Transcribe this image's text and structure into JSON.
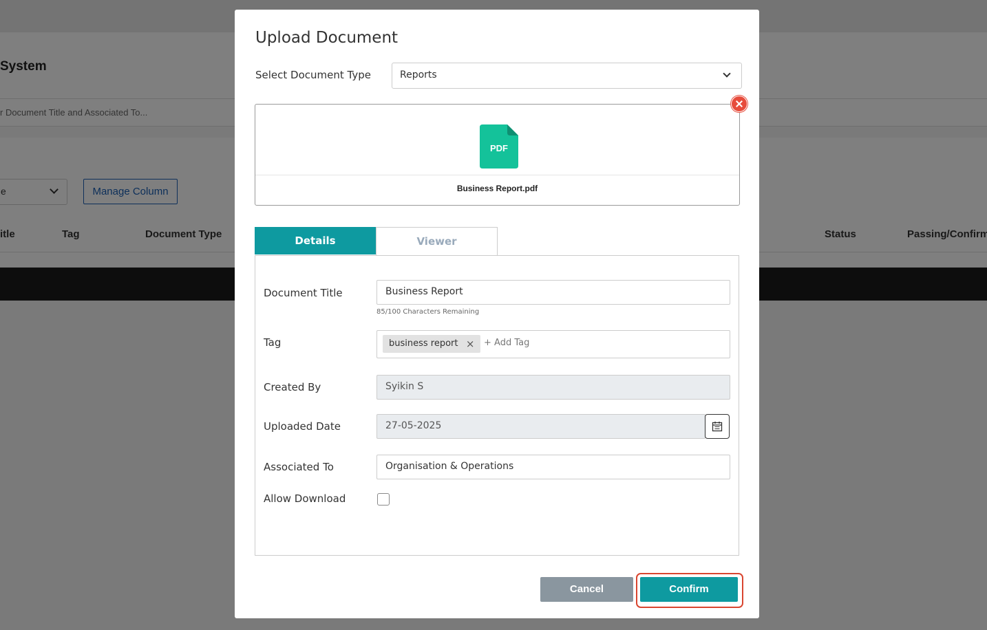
{
  "background": {
    "system_title": "System",
    "search_placeholder": "r Document Title and Associated To...",
    "select_value": "e",
    "manage_column": "Manage Column",
    "headers": [
      "itle",
      "Tag",
      "Document Type",
      "Status",
      "Passing/Confirm"
    ]
  },
  "modal": {
    "title": "Upload Document",
    "doc_type_label": "Select Document Type",
    "doc_type_value": "Reports",
    "file": {
      "icon_text": "PDF",
      "name": "Business Report.pdf",
      "icon_color": "#14c29a"
    },
    "tabs": [
      {
        "label": "Details",
        "active": true
      },
      {
        "label": "Viewer",
        "active": false
      }
    ],
    "fields": {
      "document_title": {
        "label": "Document Title",
        "value": "Business Report",
        "hint": "85/100 Characters Remaining"
      },
      "tag": {
        "label": "Tag",
        "chips": [
          "business report"
        ],
        "chip_remove": "×",
        "add_label": "+ Add Tag"
      },
      "created_by": {
        "label": "Created By",
        "value": "Syikin S"
      },
      "uploaded_date": {
        "label": "Uploaded Date",
        "value": "27-05-2025"
      },
      "associated_to": {
        "label": "Associated To",
        "value": "Organisation & Operations"
      },
      "allow_download": {
        "label": "Allow Download",
        "checked": false
      }
    },
    "buttons": {
      "cancel": "Cancel",
      "confirm": "Confirm"
    }
  },
  "colors": {
    "accent": "#0e9aa0",
    "cancel": "#8a969f",
    "highlight": "#d9452f",
    "remove": "#e74c3c"
  }
}
